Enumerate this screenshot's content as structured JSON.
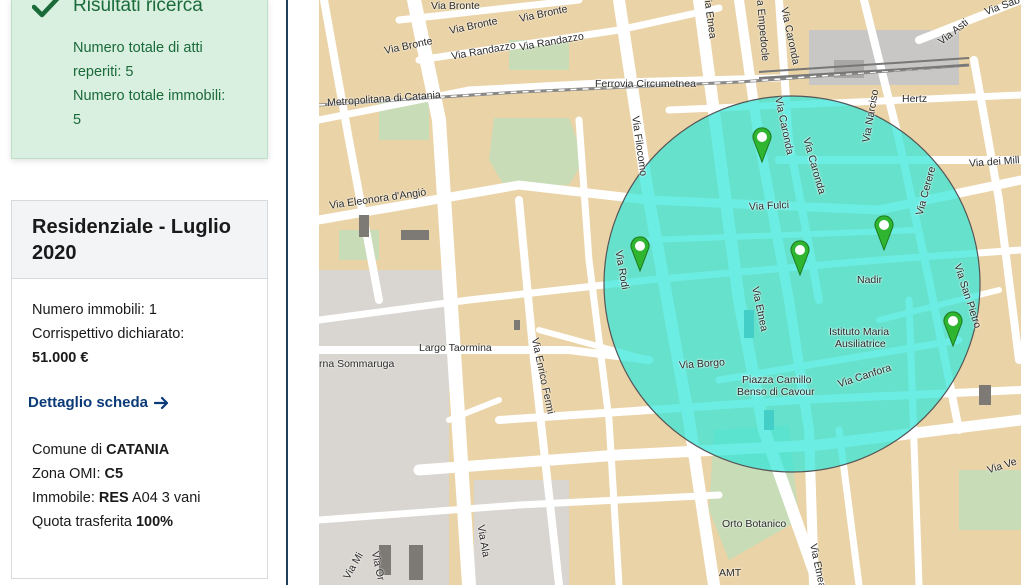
{
  "results": {
    "title": "Risultati ricerca",
    "line1a": "Numero totale di atti",
    "line1b": "reperiti: 5",
    "line2a": "Numero totale immobili:",
    "line2b": "5"
  },
  "card": {
    "title": "Residenziale - Luglio 2020",
    "immobili_label": "Numero immobili:",
    "immobili_value": "1",
    "corrispettivo_label": "Corrispettivo dichiarato:",
    "corrispettivo_value": "51.000 €",
    "detail_link": "Dettaglio scheda",
    "comune_label": "Comune di",
    "comune_value": "CATANIA",
    "zona_label": "Zona OMI:",
    "zona_value": "C5",
    "immobile_label": "Immobile:",
    "immobile_type": "RES",
    "immobile_detail": "A04 3 vani",
    "quota_label": "Quota trasferita",
    "quota_value": "100%"
  },
  "map": {
    "labels": [
      {
        "id": "via-bronte-1",
        "text": "Via Bronte"
      },
      {
        "id": "via-bronte-2",
        "text": "Via Bronte"
      },
      {
        "id": "via-bronte-3",
        "text": "Via Bronte"
      },
      {
        "id": "via-randazzo",
        "text": "Via Randazzo"
      },
      {
        "id": "via-randazzo-2",
        "text": "Via Randazzo"
      },
      {
        "id": "ferrovia",
        "text": "Ferrovia Circumetnea"
      },
      {
        "id": "metropolitana",
        "text": "Metropolitana di Catania"
      },
      {
        "id": "via-eleonora",
        "text": "Via Eleonora d'Angiò"
      },
      {
        "id": "via-filocomo",
        "text": "Via Filocomo"
      },
      {
        "id": "via-etnea-top",
        "text": "Via Etnea"
      },
      {
        "id": "via-empedocle",
        "text": "Via Empedocle"
      },
      {
        "id": "via-caronda-top",
        "text": "Via Caronda"
      },
      {
        "id": "via-caronda-2",
        "text": "Via Caronda"
      },
      {
        "id": "via-caronda-3",
        "text": "Via Caronda"
      },
      {
        "id": "via-narciso",
        "text": "Via Narciso"
      },
      {
        "id": "hertz",
        "text": "Hertz"
      },
      {
        "id": "via-asti",
        "text": "Via Asti"
      },
      {
        "id": "via-sabotino",
        "text": "Via Sab"
      },
      {
        "id": "via-dei-mille",
        "text": "Via dei Mill"
      },
      {
        "id": "via-cerere",
        "text": "Via Cerere"
      },
      {
        "id": "via-fulci",
        "text": "Via Fulci"
      },
      {
        "id": "via-rodi",
        "text": "Via Rodi"
      },
      {
        "id": "nadir",
        "text": "Nadir"
      },
      {
        "id": "via-san-pietro",
        "text": "Via San Pietro"
      },
      {
        "id": "istituto-1",
        "text": "Istituto Maria"
      },
      {
        "id": "istituto-2",
        "text": "Ausiliatrice"
      },
      {
        "id": "via-etnea-mid",
        "text": "Via Etnea"
      },
      {
        "id": "via-borgo",
        "text": "Via Borgo"
      },
      {
        "id": "piazza-1",
        "text": "Piazza Camillo"
      },
      {
        "id": "piazza-2",
        "text": "Benso di Cavour"
      },
      {
        "id": "via-canfora",
        "text": "Via Canfora"
      },
      {
        "id": "largo-taormina",
        "text": "Largo Taormina"
      },
      {
        "id": "via-enrico-fermi",
        "text": "Via Enrico Fermi"
      },
      {
        "id": "sommaruga",
        "text": "rna Sommaruga"
      },
      {
        "id": "orto-botanico",
        "text": "Orto Botanico"
      },
      {
        "id": "via-ala",
        "text": "Via Ala"
      },
      {
        "id": "amt",
        "text": "AMT"
      },
      {
        "id": "via-etnea-bottom",
        "text": "Via Etnea"
      },
      {
        "id": "via-ve",
        "text": "Via Ve"
      },
      {
        "id": "via-mi",
        "text": "Via Mi"
      },
      {
        "id": "via-or",
        "text": "Via Or"
      }
    ],
    "colors": {
      "land": "#ead3a6",
      "road": "#ffffff",
      "circle_fill": "#33e6d9",
      "circle_stroke": "#555555",
      "pin": "#2fb52f"
    }
  }
}
